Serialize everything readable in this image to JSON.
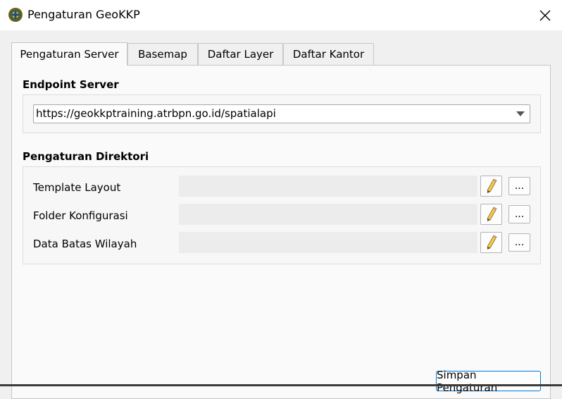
{
  "window": {
    "title": "Pengaturan GeoKKP",
    "app_icon": "geokkp-logo-icon",
    "close_icon": "close-icon"
  },
  "tabs": [
    {
      "label": "Pengaturan Server",
      "active": true
    },
    {
      "label": "Basemap",
      "active": false
    },
    {
      "label": "Daftar Layer",
      "active": false
    },
    {
      "label": "Daftar Kantor",
      "active": false
    }
  ],
  "endpoint": {
    "section_title": "Endpoint Server",
    "selected_value": "https://geokkptraining.atrbpn.go.id/spatialapi",
    "dropdown_icon": "chevron-down-icon"
  },
  "directories": {
    "section_title": "Pengaturan Direktori",
    "rows": [
      {
        "label": "Template Layout",
        "value": "",
        "edit_icon": "pencil-icon",
        "browse_label": "..."
      },
      {
        "label": "Folder Konfigurasi",
        "value": "",
        "edit_icon": "pencil-icon",
        "browse_label": "..."
      },
      {
        "label": "Data Batas Wilayah",
        "value": "",
        "edit_icon": "pencil-icon",
        "browse_label": "..."
      }
    ]
  },
  "footer": {
    "save_label": "Simpan Pengaturan"
  },
  "colors": {
    "accent": "#0078d7",
    "window_bg": "#f0f0f0",
    "panel_bg": "#fafafa",
    "pencil_yellow": "#f2c94c"
  }
}
